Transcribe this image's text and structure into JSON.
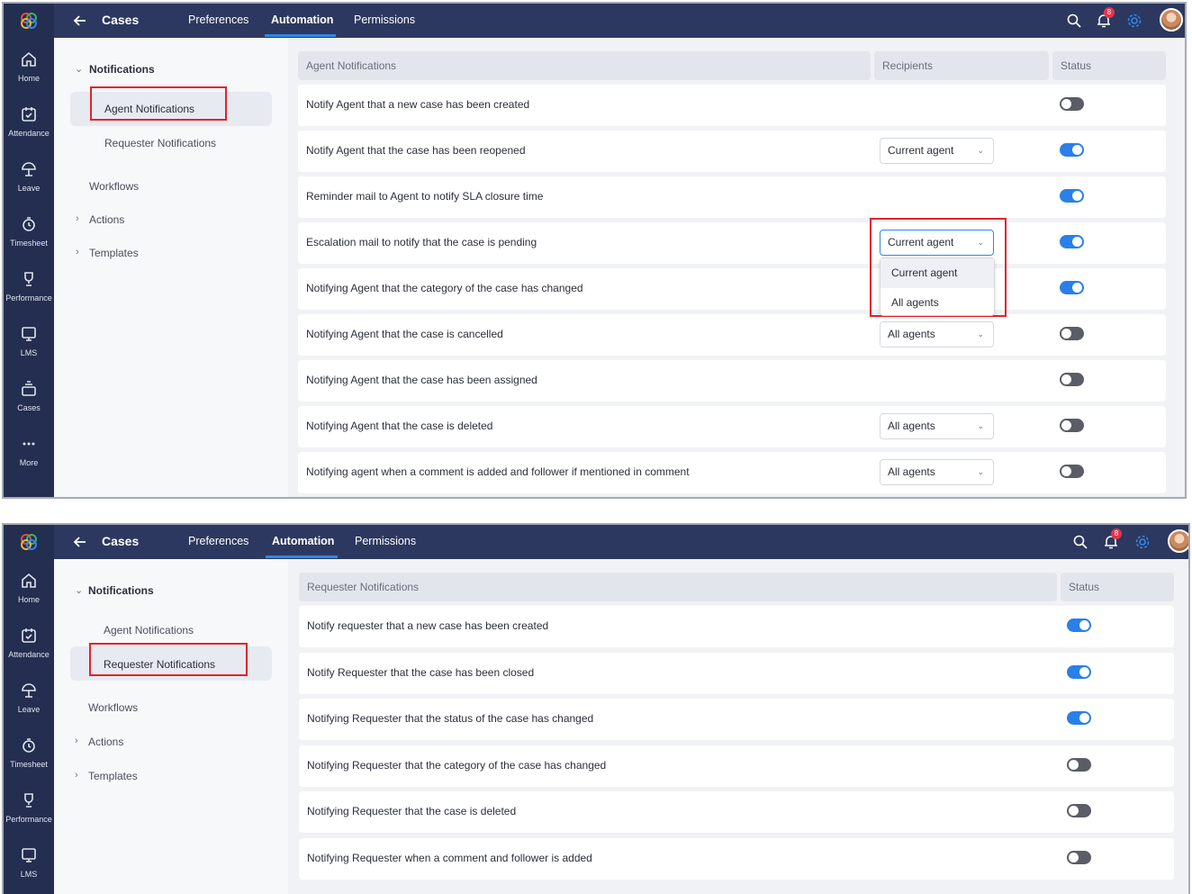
{
  "colors": {
    "rail_bg": "#232e50",
    "topbar_bg": "#2c385f",
    "accent": "#2f87ea",
    "toggle_on": "#2a7fe8",
    "toggle_off": "#5a5d66",
    "highlight_box": "#e0242c",
    "badge": "#e5344b"
  },
  "rail": {
    "logo_icon": "app-logo-icon",
    "items": [
      {
        "label": "Home",
        "icon": "home-icon"
      },
      {
        "label": "Attendance",
        "icon": "calendar-check-icon"
      },
      {
        "label": "Leave",
        "icon": "beach-umbrella-icon"
      },
      {
        "label": "Timesheet",
        "icon": "timer-icon"
      },
      {
        "label": "Performance",
        "icon": "trophy-icon"
      },
      {
        "label": "LMS",
        "icon": "monitor-icon"
      },
      {
        "label": "Cases",
        "icon": "tray-icon"
      },
      {
        "label": "More",
        "icon": "more-dots-icon"
      }
    ]
  },
  "topbar": {
    "title": "Cases",
    "tabs": [
      "Preferences",
      "Automation",
      "Permissions"
    ],
    "active_tab": "Automation",
    "notification_count": "8",
    "icons": [
      "back-arrow-icon",
      "search-icon",
      "bell-icon",
      "gear-icon",
      "user-avatar"
    ]
  },
  "subnav": {
    "section": "Notifications",
    "items": [
      "Agent Notifications",
      "Requester Notifications"
    ],
    "other": [
      "Workflows",
      "Actions",
      "Templates"
    ]
  },
  "agent": {
    "columns": [
      "Agent Notifications",
      "Recipients",
      "Status"
    ],
    "rows": [
      {
        "label": "Notify Agent that a new case has been created",
        "recipient": "",
        "enabled": false
      },
      {
        "label": "Notify Agent that the case has been reopened",
        "recipient": "Current agent",
        "enabled": true
      },
      {
        "label": "Reminder mail to Agent to notify SLA closure time",
        "recipient": "",
        "enabled": true
      },
      {
        "label": "Escalation mail to notify that the case is pending",
        "recipient": "Current agent",
        "enabled": true
      },
      {
        "label": "Notifying Agent that the category of the case has changed",
        "recipient": "",
        "enabled": true
      },
      {
        "label": "Notifying Agent that the case is cancelled",
        "recipient": "All agents",
        "enabled": false
      },
      {
        "label": "Notifying Agent that the case has been assigned",
        "recipient": "",
        "enabled": false
      },
      {
        "label": "Notifying Agent that the case is deleted",
        "recipient": "All agents",
        "enabled": false
      },
      {
        "label": "Notifying agent when a comment is added and follower if mentioned in comment",
        "recipient": "All agents",
        "enabled": false
      }
    ],
    "dropdown_options": [
      "Current agent",
      "All agents"
    ],
    "dropdown_highlighted": "Current agent"
  },
  "requester": {
    "columns": [
      "Requester Notifications",
      "Status"
    ],
    "rows": [
      {
        "label": "Notify requester that a new case has been created",
        "enabled": true
      },
      {
        "label": "Notify Requester that the case has been closed",
        "enabled": true
      },
      {
        "label": "Notifying Requester that the status of the case has changed",
        "enabled": true
      },
      {
        "label": "Notifying Requester that the category of the case has changed",
        "enabled": false
      },
      {
        "label": "Notifying Requester that the case is deleted",
        "enabled": false
      },
      {
        "label": "Notifying Requester when a comment and follower is added",
        "enabled": false
      }
    ]
  }
}
